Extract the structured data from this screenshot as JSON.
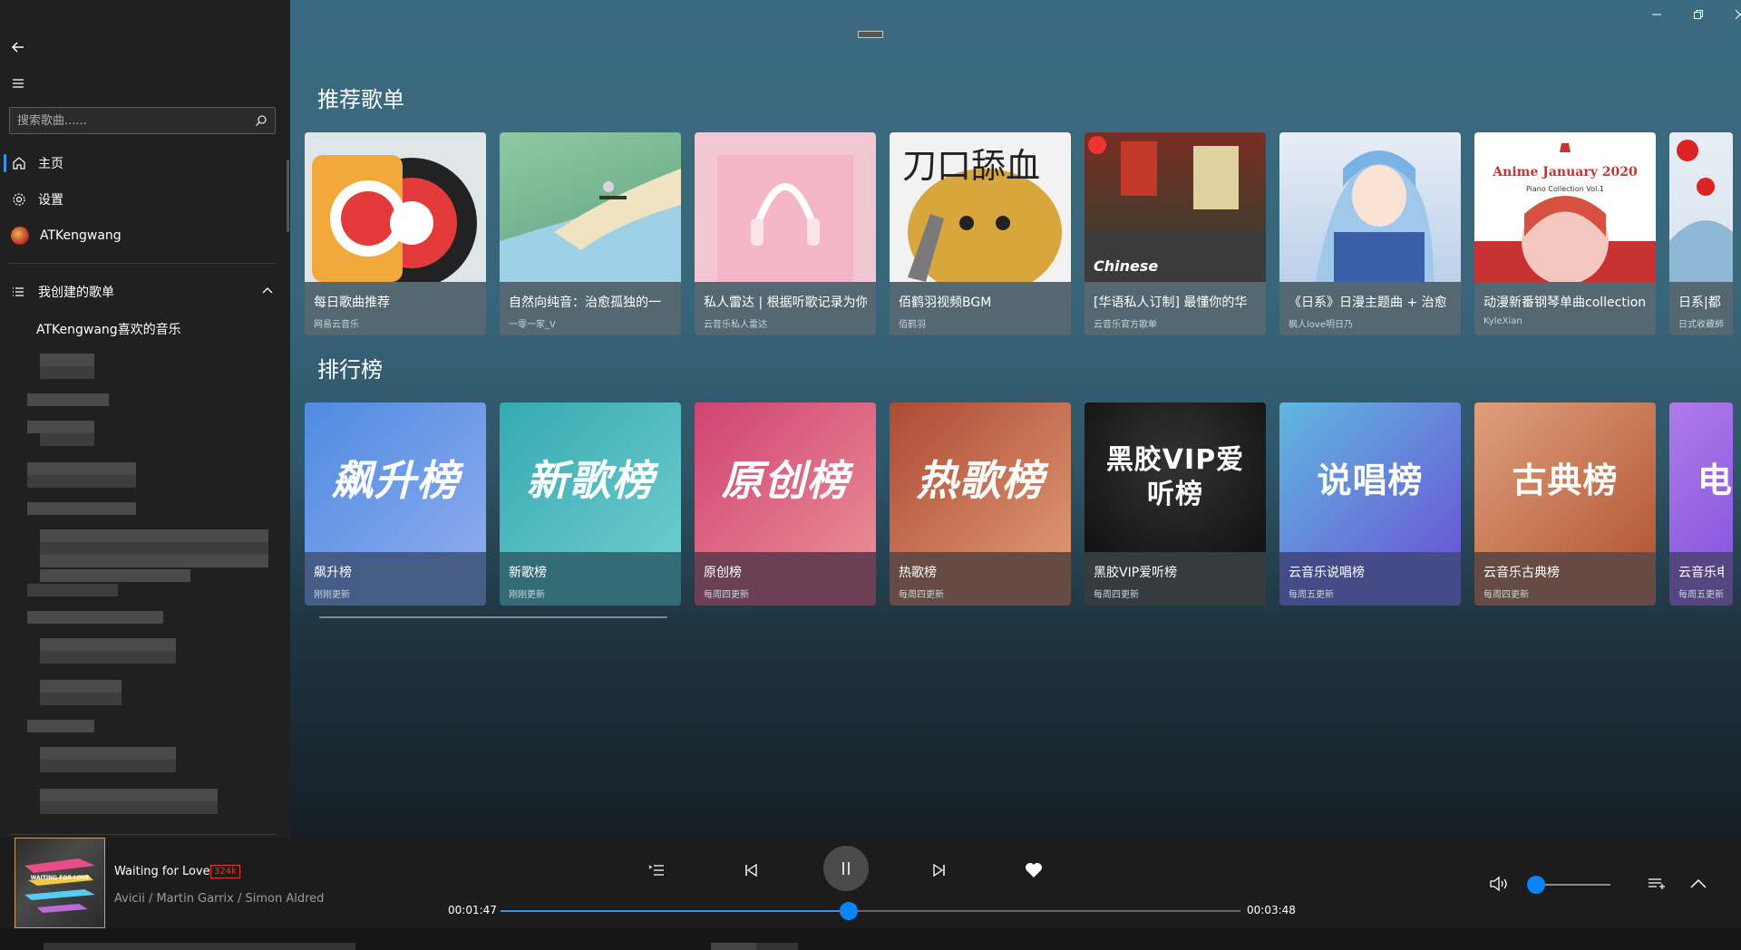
{
  "sidebar": {
    "search_placeholder": "搜索歌曲......",
    "nav": [
      {
        "label": "主页"
      },
      {
        "label": "设置"
      },
      {
        "label": "ATKengwang"
      }
    ],
    "created_playlists_label": "我创建的歌单",
    "favorite_playlist": "ATKengwang喜欢的音乐"
  },
  "main": {
    "recommended_title": "推荐歌单",
    "recommended": [
      {
        "title": "每日歌曲推荐",
        "sub": "网易云音乐"
      },
      {
        "title": "自然向纯音：治愈孤独的一",
        "sub": "一零一家_V"
      },
      {
        "title": "私人雷达 | 根据听歌记录为你",
        "sub": "云音乐私人雷达"
      },
      {
        "title": "佰鹤羽视频BGM",
        "sub": "佰鹤羽"
      },
      {
        "title": "[华语私人订制] 最懂你的华",
        "sub": "云音乐官方歌单"
      },
      {
        "title": "《日系》日漫主题曲 + 治愈",
        "sub": "枫人love明日乃"
      },
      {
        "title": "动漫新番钢琴单曲collection",
        "sub": "KyleXian"
      },
      {
        "title": "日系|都",
        "sub": "日式收藏師"
      }
    ],
    "recommended_art_text": {
      "card4": "刀口舔血",
      "card5": "Chinese",
      "card7_title": "Anime January 2020",
      "card7_sub": "Piano Collection Vol.1"
    },
    "charts_title": "排行榜",
    "charts": [
      {
        "art": "飙升榜",
        "title": "飙升榜",
        "sub": "刚刚更新"
      },
      {
        "art": "新歌榜",
        "title": "新歌榜",
        "sub": "刚刚更新"
      },
      {
        "art": "原创榜",
        "title": "原创榜",
        "sub": "每周四更新"
      },
      {
        "art": "热歌榜",
        "title": "热歌榜",
        "sub": "每周四更新"
      },
      {
        "art": "黑胶VIP爱听榜",
        "title": "黑胶VIP爱听榜",
        "sub": "每周四更新"
      },
      {
        "art": "说唱榜",
        "title": "云音乐说唱榜",
        "sub": "每周五更新"
      },
      {
        "art": "古典榜",
        "title": "云音乐古典榜",
        "sub": "每周四更新"
      },
      {
        "art": "电",
        "title": "云音乐电",
        "sub": "每周五更新"
      }
    ],
    "colors": {
      "chart_gradients": [
        [
          "#4f8be0",
          "#7aa0e8"
        ],
        [
          "#3fb3b8",
          "#63c4c7"
        ],
        [
          "#d44e78",
          "#e37b8a"
        ],
        [
          "#b8563a",
          "#d98a63"
        ],
        [
          "#1a1a1a",
          "#2d2d2d"
        ],
        [
          "#6a5ad6",
          "#5fb8e0"
        ],
        [
          "#b45a3a",
          "#e0a07a"
        ],
        [
          "#8a5ae0",
          "#b07ae8"
        ]
      ]
    }
  },
  "player": {
    "song_title": "Waiting for Love",
    "quality": "324k",
    "artists": "Avicii / Martin Garrix / Simon Aldred",
    "current_time": "00:01:47",
    "total_time": "00:03:48",
    "progress": 0.47,
    "volume": 0.0,
    "cover_text": "WAITING FOR LOVE"
  }
}
